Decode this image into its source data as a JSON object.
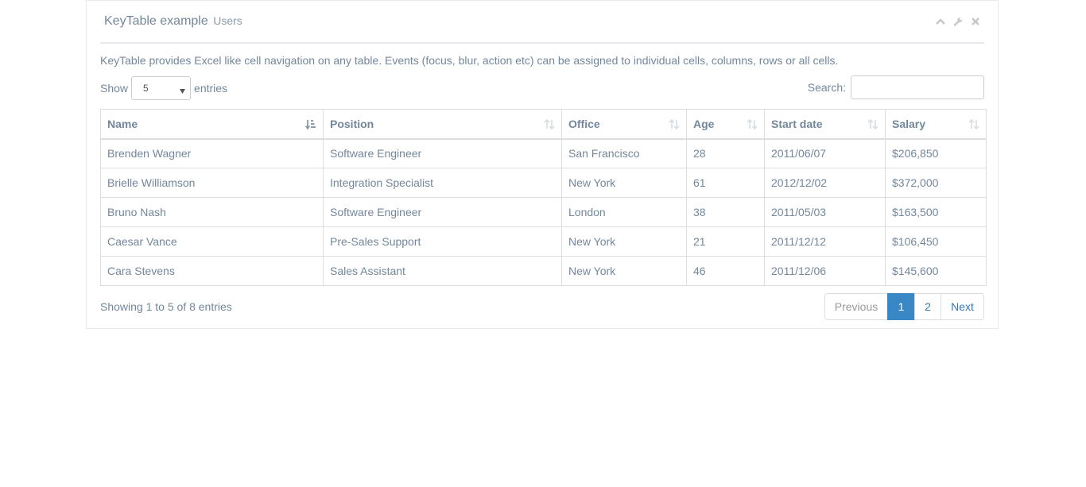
{
  "panel": {
    "title": "KeyTable example",
    "subtitle": "Users",
    "tools": [
      "collapse-icon",
      "wrench-icon",
      "close-icon"
    ]
  },
  "description": "KeyTable provides Excel like cell navigation on any table. Events (focus, blur, action etc) can be assigned to individual cells, columns, rows or all cells.",
  "length": {
    "prefix": "Show",
    "value": "5",
    "suffix": "entries"
  },
  "search": {
    "label": "Search:",
    "value": ""
  },
  "table": {
    "columns": [
      "Name",
      "Position",
      "Office",
      "Age",
      "Start date",
      "Salary"
    ],
    "rows": [
      [
        "Brenden Wagner",
        "Software Engineer",
        "San Francisco",
        "28",
        "2011/06/07",
        "$206,850"
      ],
      [
        "Brielle Williamson",
        "Integration Specialist",
        "New York",
        "61",
        "2012/12/02",
        "$372,000"
      ],
      [
        "Bruno Nash",
        "Software Engineer",
        "London",
        "38",
        "2011/05/03",
        "$163,500"
      ],
      [
        "Caesar Vance",
        "Pre-Sales Support",
        "New York",
        "21",
        "2011/12/12",
        "$106,450"
      ],
      [
        "Cara Stevens",
        "Sales Assistant",
        "New York",
        "46",
        "2011/12/06",
        "$145,600"
      ]
    ]
  },
  "info": "Showing 1 to 5 of 8 entries",
  "pagination": {
    "previous": "Previous",
    "pages": [
      "1",
      "2"
    ],
    "next": "Next"
  },
  "colors": {
    "accent": "#3a87c5",
    "text": "#73879c",
    "link": "#337ab7"
  }
}
